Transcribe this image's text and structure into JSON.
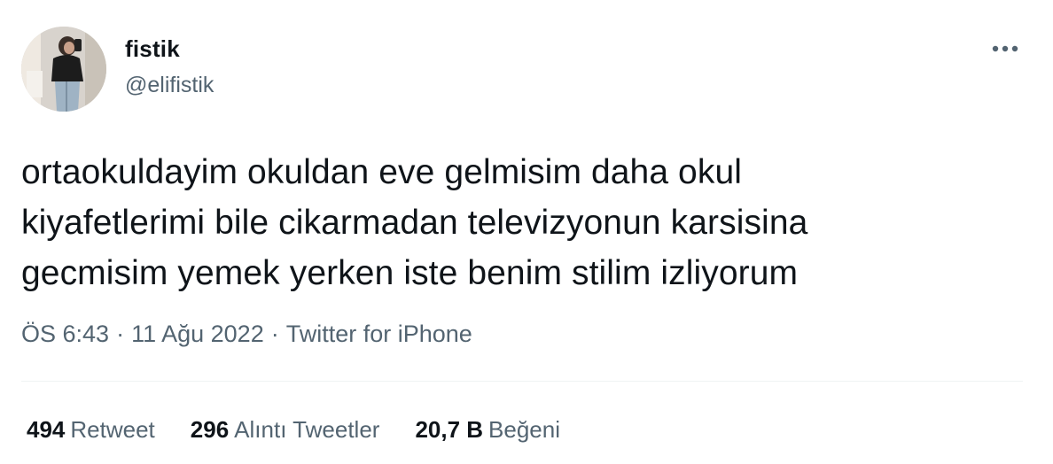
{
  "user": {
    "display_name": "fistik",
    "handle": "@elifistik",
    "avatar_icon": "profile-photo"
  },
  "tweet": {
    "lines": [
      "ortaokuldayim okuldan eve gelmisim daha okul",
      "kiyafetlerimi bile cikarmadan televizyonun karsisina",
      "gecmisim yemek yerken iste benim stilim izliyorum"
    ],
    "time": "ÖS 6:43",
    "date": "11 Ağu 2022",
    "source": "Twitter for iPhone",
    "separator": "·"
  },
  "stats": {
    "retweets": {
      "count": "494",
      "label": "Retweet"
    },
    "quotes": {
      "count": "296",
      "label": "Alıntı Tweetler"
    },
    "likes": {
      "count": "20,7 B",
      "label": "Beğeni"
    }
  },
  "colors": {
    "text": "#0f1419",
    "secondary": "#536471",
    "divider": "#eff3f4"
  },
  "more_icon": "more-horizontal-icon"
}
